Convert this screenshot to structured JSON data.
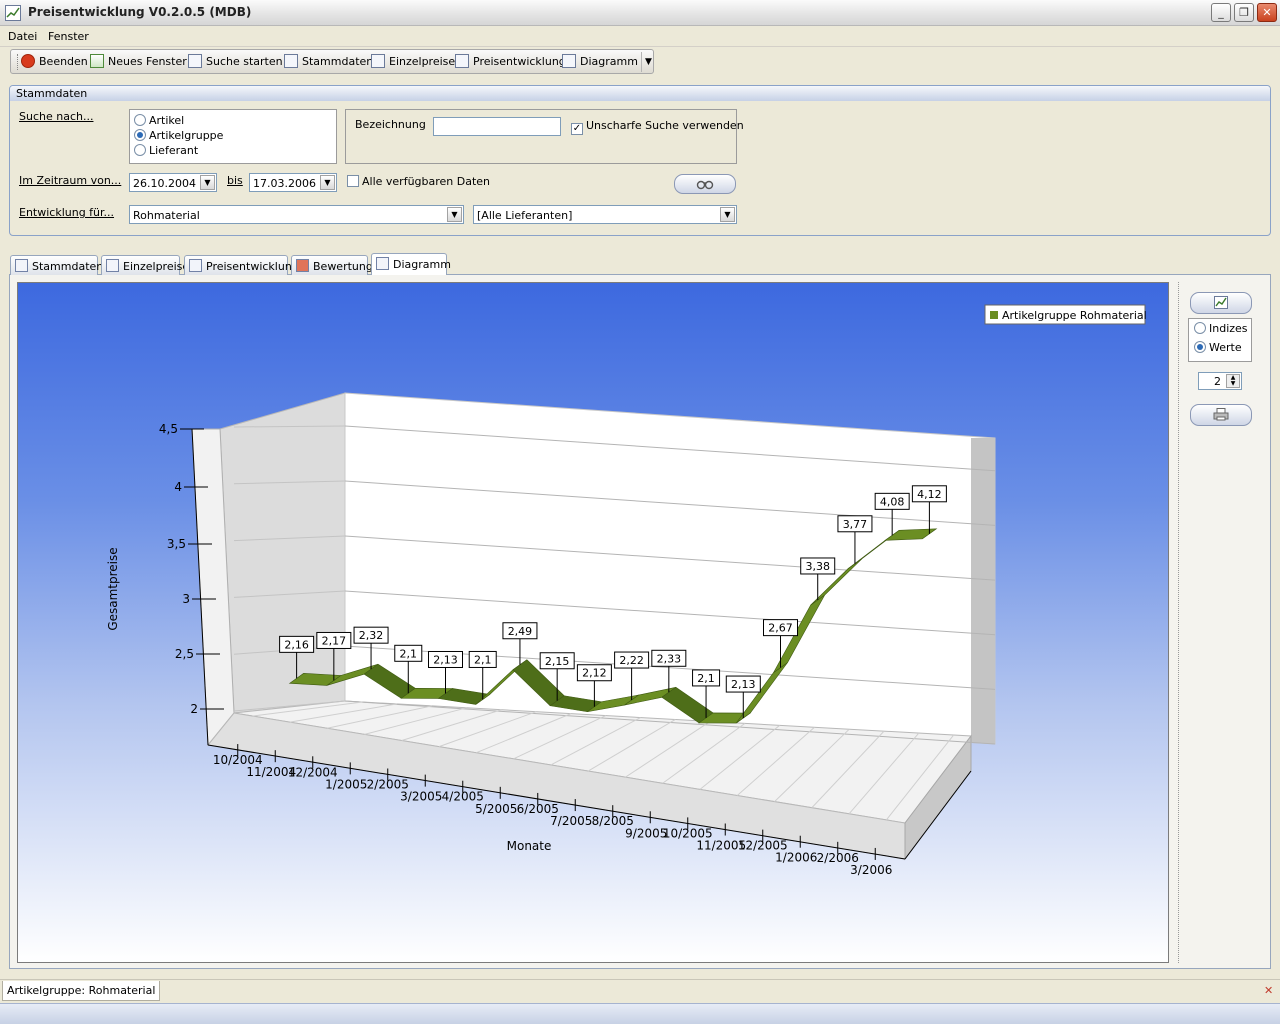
{
  "window": {
    "title": "Preisentwicklung V0.2.0.5 (MDB)",
    "minimize": "_",
    "restore": "❐",
    "close": "✕"
  },
  "menu": {
    "file": "Datei",
    "window": "Fenster"
  },
  "toolbar": {
    "quit": "Beenden",
    "new_window": "Neues Fenster",
    "search": "Suche starten",
    "master_data": "Stammdaten",
    "single_prices": "Einzelpreise",
    "price_development": "Preisentwicklung",
    "diagram": "Diagramm",
    "more": "▼"
  },
  "stammdaten": {
    "title": "Stammdaten",
    "search_by_label": "Suche nach...",
    "search_options": [
      "Artikel",
      "Artikelgruppe",
      "Lieferant"
    ],
    "search_selected": "Artikelgruppe",
    "designation_label": "Bezeichnung",
    "designation_value": "",
    "fuzzy_label": "Unscharfe Suche verwenden",
    "fuzzy_checked": true,
    "period_label": "Im Zeitraum von...",
    "from_date": "26.10.2004",
    "to_label": "bis",
    "to_date": "17.03.2006",
    "all_data_label": "Alle verfügbaren Daten",
    "all_data_checked": false,
    "development_label": "Entwicklung für...",
    "development_value": "Rohmaterial",
    "supplier_value": "[Alle Lieferanten]"
  },
  "tabs": [
    {
      "label": "Stammdaten"
    },
    {
      "label": "Einzelpreise"
    },
    {
      "label": "Preisentwicklung"
    },
    {
      "label": "Bewertung"
    },
    {
      "label": "Diagramm"
    }
  ],
  "active_tab": "Diagramm",
  "side": {
    "options": [
      "Indizes",
      "Werte"
    ],
    "selected": "Werte",
    "decimals": "2"
  },
  "status": {
    "text": "Artikelgruppe: Rohmaterial"
  },
  "colors": {
    "series": "#6b8e23",
    "chart_top": "#3d69df",
    "chart_bottom": "#ffffff"
  },
  "chart_data": {
    "type": "area",
    "title": "",
    "xlabel": "Monate",
    "ylabel": "Gesamtpreise",
    "x": [
      "10/2004",
      "11/2004",
      "12/2004",
      "1/2005",
      "2/2005",
      "3/2005",
      "4/2005",
      "5/2005",
      "6/2005",
      "7/2005",
      "8/2005",
      "9/2005",
      "10/2005",
      "11/2005",
      "12/2005",
      "1/2006",
      "2/2006",
      "3/2006"
    ],
    "series": [
      {
        "name": "Artikelgruppe Rohmaterial",
        "values": [
          2.16,
          2.17,
          2.32,
          2.1,
          2.13,
          2.1,
          2.49,
          2.15,
          2.12,
          2.22,
          2.33,
          2.1,
          2.13,
          2.67,
          3.38,
          3.77,
          4.08,
          4.12
        ]
      }
    ],
    "yticks": [
      "2",
      "2,5",
      "3",
      "3,5",
      "4",
      "4,5"
    ],
    "ylim": [
      2,
      4.5
    ],
    "grid": true,
    "legend": "top-right",
    "projection": "3d"
  }
}
